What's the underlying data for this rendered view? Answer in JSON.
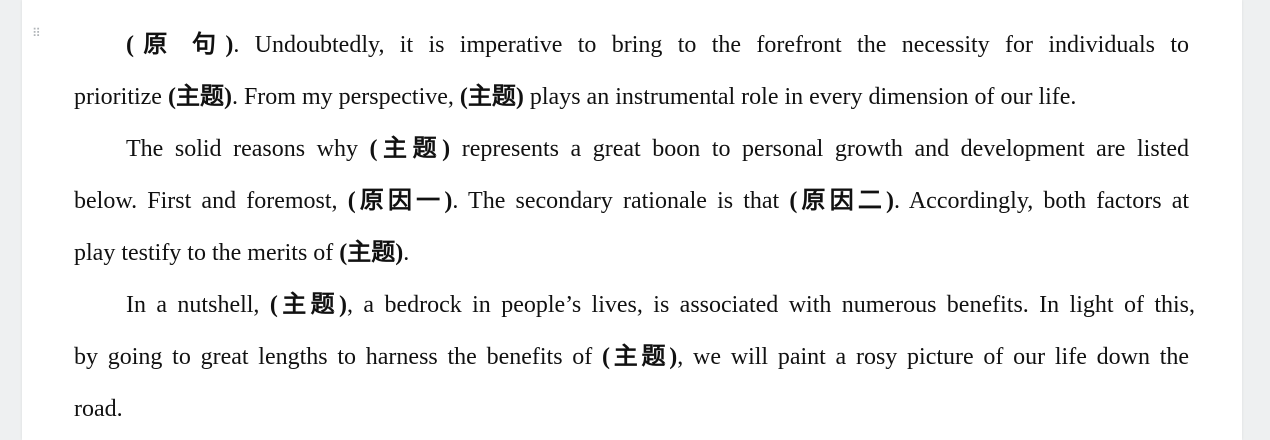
{
  "document": {
    "paragraphs": [
      {
        "lines": [
          [
            [
              "(原 句)",
              true
            ],
            [
              ". Undoubtedly, it is imperative to bring to the forefront the necessity for individuals to",
              false
            ]
          ],
          [
            [
              "prioritize ",
              false
            ],
            [
              "(主题)",
              true
            ],
            [
              ". From my perspective, ",
              false
            ],
            [
              "(主题)",
              true
            ],
            [
              " plays an instrumental role in every dimension of our life.",
              false
            ]
          ]
        ]
      },
      {
        "lines": [
          [
            [
              "The solid reasons why ",
              false
            ],
            [
              "(主题)",
              true
            ],
            [
              " represents a great boon to personal growth and development are listed",
              false
            ]
          ],
          [
            [
              "below. First and foremost, ",
              false
            ],
            [
              "(原因一)",
              true
            ],
            [
              ". The secondary rationale is that ",
              false
            ],
            [
              "(原因二)",
              true
            ],
            [
              ". Accordingly, both factors at",
              false
            ]
          ],
          [
            [
              "play testify to the merits of ",
              false
            ],
            [
              "(主题)",
              true
            ],
            [
              ".",
              false
            ]
          ]
        ]
      },
      {
        "lines": [
          [
            [
              "In a nutshell, ",
              false
            ],
            [
              "(主题)",
              true
            ],
            [
              ", a bedrock in people’s lives, is associated with numerous benefits. In light of this,",
              false
            ]
          ],
          [
            [
              "by going to great lengths to harness the benefits of ",
              false
            ],
            [
              "(主题)",
              true
            ],
            [
              ", we will paint a rosy picture of our life down the",
              false
            ]
          ],
          [
            [
              "road.",
              false
            ]
          ]
        ]
      }
    ]
  }
}
